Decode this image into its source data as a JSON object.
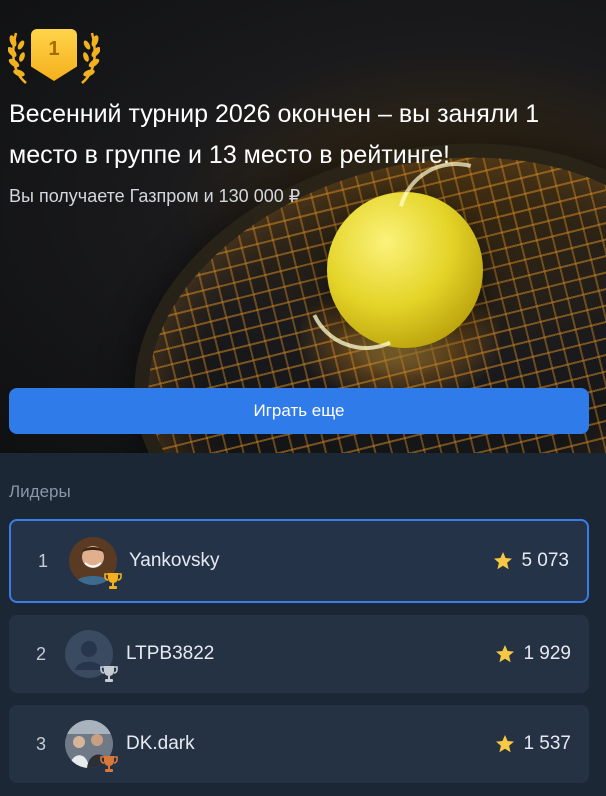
{
  "hero": {
    "badge_number": "1",
    "title": "Весенний турнир 2026 окончен – вы заняли 1 место в группе и 13 место в рейтинге!",
    "subtitle": "Вы получаете Газпром и 130 000 ₽",
    "play_button": "Играть еще"
  },
  "leaders": {
    "title": "Лидеры",
    "rows": [
      {
        "rank": "1",
        "name": "Yankovsky",
        "score": "5 073",
        "trophy": "gold-trophy-icon"
      },
      {
        "rank": "2",
        "name": "LTPB3822",
        "score": "1 929",
        "trophy": "silver-trophy-icon"
      },
      {
        "rank": "3",
        "name": "DK.dark",
        "score": "1 537",
        "trophy": "bronze-trophy-icon"
      }
    ]
  },
  "colors": {
    "accent": "#2f7bea",
    "gold": "#f4b01c",
    "silver": "#c7ccd3",
    "bronze": "#d9763a",
    "star": "#f7c843"
  }
}
